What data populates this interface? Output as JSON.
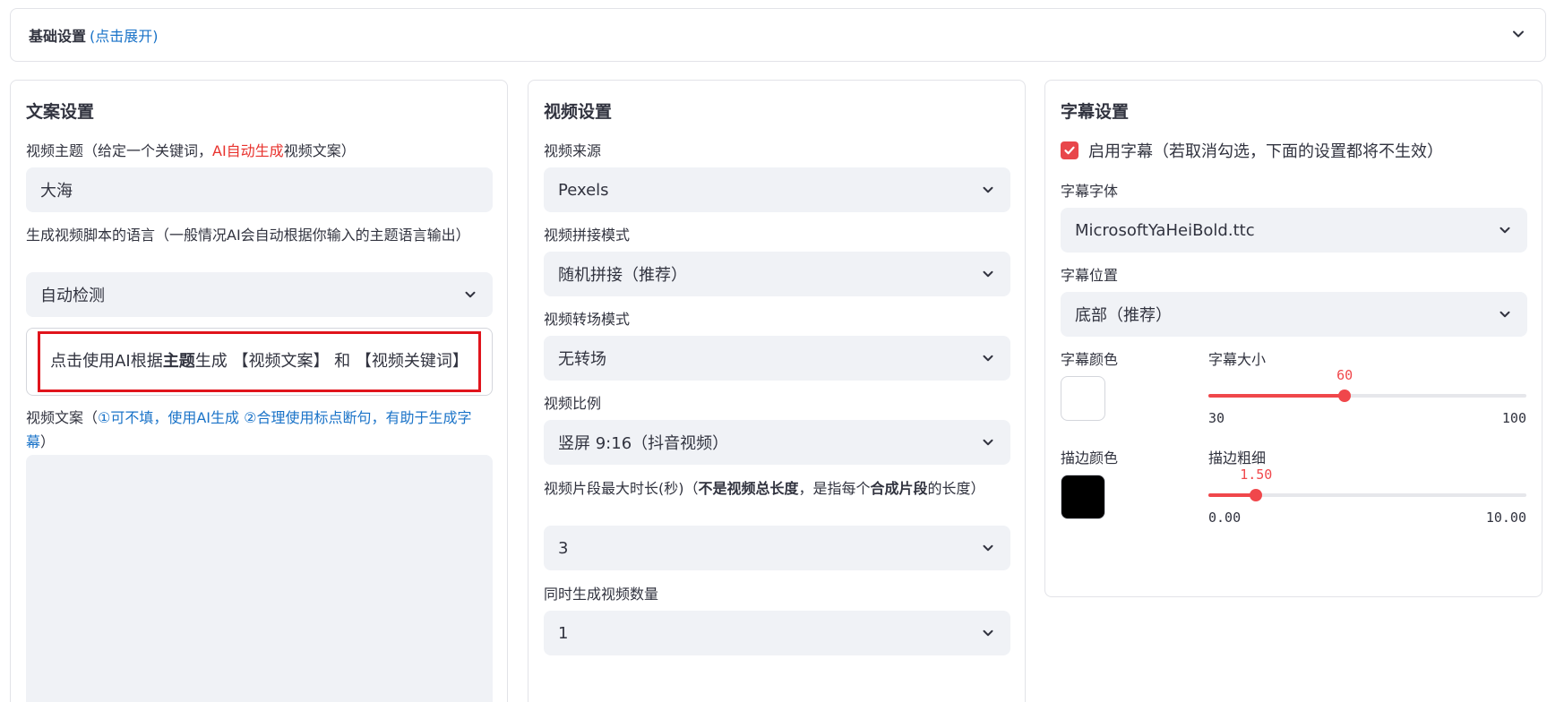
{
  "basic": {
    "title": "基础设置",
    "hint": "(点击展开)"
  },
  "copy": {
    "heading": "文案设置",
    "topic_label_a": "视频主题（给定一个关键词，",
    "topic_label_red": "AI自动生成",
    "topic_label_b": "视频文案）",
    "topic_value": "大海",
    "lang_label": "生成视频脚本的语言（一般情况AI会自动根据你输入的主题语言输出）",
    "lang_value": "自动检测",
    "ai_btn_a": "点击使用AI根据",
    "ai_btn_bold": "主题",
    "ai_btn_b": "生成 【视频文案】 和 【视频关键词】",
    "script_label_a": "视频文案（",
    "script_label_blue": "①可不填，使用AI生成 ②合理使用标点断句，有助于生成字幕",
    "script_label_b": "）"
  },
  "video": {
    "heading": "视频设置",
    "source_label": "视频来源",
    "source_value": "Pexels",
    "concat_label": "视频拼接模式",
    "concat_value": "随机拼接（推荐）",
    "transition_label": "视频转场模式",
    "transition_value": "无转场",
    "ratio_label": "视频比例",
    "ratio_value": "竖屏 9:16（抖音视频）",
    "clip_label_a": "视频片段最大时长(秒)（",
    "clip_label_bold1": "不是视频总长度",
    "clip_label_b": "，是指每个",
    "clip_label_bold2": "合成片段",
    "clip_label_c": "的长度）",
    "clip_value": "3",
    "count_label": "同时生成视频数量",
    "count_value": "1"
  },
  "subtitle": {
    "heading": "字幕设置",
    "enable_label": "启用字幕（若取消勾选，下面的设置都将不生效）",
    "enabled": true,
    "font_label": "字幕字体",
    "font_value": "MicrosoftYaHeiBold.ttc",
    "position_label": "字幕位置",
    "position_value": "底部（推荐）",
    "color_label": "字幕颜色",
    "color_value": "#FFFFFF",
    "size_label": "字幕大小",
    "size": {
      "value": 60,
      "min": 30,
      "max": 100,
      "value_text": "60",
      "min_text": "30",
      "max_text": "100"
    },
    "stroke_color_label": "描边颜色",
    "stroke_color_value": "#000000",
    "stroke_width_label": "描边粗细",
    "stroke": {
      "value": 1.5,
      "min": 0,
      "max": 10,
      "value_text": "1.50",
      "min_text": "0.00",
      "max_text": "10.00"
    }
  },
  "colors": {
    "accent": "#f0474b",
    "link": "#1a73c8",
    "highlight_box": "#e0141c",
    "field_bg": "#f0f2f6"
  }
}
